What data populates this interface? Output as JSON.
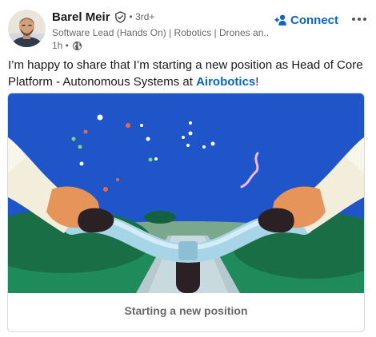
{
  "author": {
    "name": "Barel Meir",
    "degree": "• 3rd+",
    "headline": "Software Lead (Hands On) | Robotics | Drones an...",
    "time": "1h •"
  },
  "actions": {
    "connect_label": "Connect",
    "more_label": "•••"
  },
  "post": {
    "text_before": "I’m happy to share that I’m starting a new position as Head of Core Platform - Autonomous Systems at ",
    "mention": "Airobotics",
    "text_after": "!"
  },
  "card": {
    "caption": "Starting a new position"
  },
  "colors": {
    "accent": "#0a66c2",
    "sky": "#1f55c9",
    "grass": "#1f8a5a"
  },
  "icons": {
    "verify": "shield-check-icon",
    "globe": "globe-icon",
    "connect": "person-plus-icon",
    "more": "ellipsis-icon"
  }
}
